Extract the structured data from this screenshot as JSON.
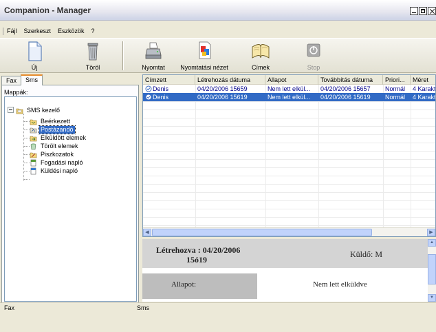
{
  "window": {
    "title": "Companion - Manager"
  },
  "menu": [
    "Fájl",
    "Szerkeszt",
    "Eszközök",
    "?"
  ],
  "toolbar": {
    "new": "Új",
    "delete": "Töröl",
    "print": "Nyomtat",
    "print_preview": "Nyomtatási nézet",
    "addresses": "Címek",
    "stop": "Stop"
  },
  "tabs": [
    "Fax",
    "Sms"
  ],
  "folders_label": "Mappák:",
  "tree": [
    {
      "label": "SMS kezelő",
      "icon": "sms-folder-icon"
    },
    {
      "label": "Beérkezett",
      "icon": "inbox-icon"
    },
    {
      "label": "Postázandó",
      "icon": "outbox-icon",
      "selected": true
    },
    {
      "label": "Elküldött elemek",
      "icon": "sent-items-icon"
    },
    {
      "label": "Törölt elemek",
      "icon": "deleted-items-icon"
    },
    {
      "label": "Piszkozatok",
      "icon": "drafts-icon"
    },
    {
      "label": "Fogadási napló",
      "icon": "receive-log-icon"
    },
    {
      "label": "Küldési napló",
      "icon": "send-log-icon"
    }
  ],
  "list": {
    "columns": [
      "Címzett",
      "Létrehozás dátuma",
      "Allapot",
      "Továbbítás dátuma",
      "Priori...",
      "Méret"
    ],
    "rows": [
      {
        "cells": [
          "Denis",
          "04/20/2006 15659",
          "Nem lett elkül...",
          "04/20/2006 15657",
          "Normál",
          "4 Karakt"
        ],
        "selected": false
      },
      {
        "cells": [
          "Denis",
          "04/20/2006 15619",
          "Nem lett elkül...",
          "04/20/2006 15619",
          "Normál",
          "4 Karakt"
        ],
        "selected": true
      }
    ]
  },
  "detail": {
    "created_label": "Létrehozva : 04/20/2006",
    "created_time": "15ó19",
    "sender": "Küldő: M",
    "status_label": "Allapot:",
    "status_value": "Nem lett elküldve"
  },
  "statusbar": {
    "left": "Fax",
    "right": "Sms"
  },
  "colors": {
    "selection": "#316ac5",
    "tab_accent": "#e68b2c",
    "link_text": "#00008b"
  }
}
